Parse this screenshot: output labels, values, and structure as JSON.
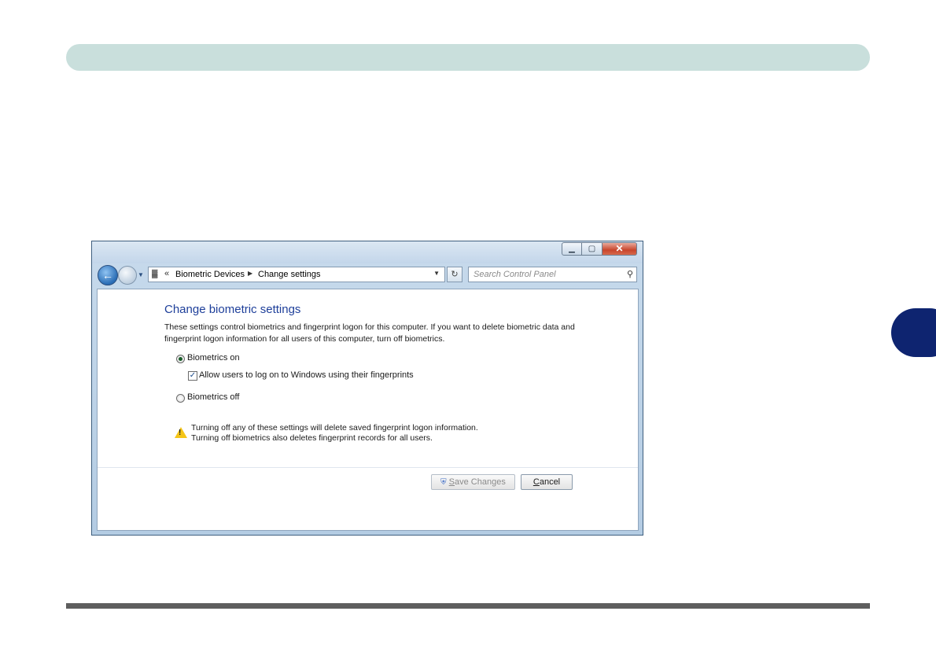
{
  "window": {
    "caption": {
      "minimize": "▁",
      "maximize": "▢",
      "close": "✕"
    }
  },
  "address": {
    "chevrons": "«",
    "crumbs": [
      "Biometric Devices",
      "Change settings"
    ]
  },
  "search": {
    "placeholder": "Search Control Panel"
  },
  "page": {
    "title": "Change biometric settings",
    "description": "These settings control biometrics and fingerprint logon for this computer. If you want to delete biometric data and fingerprint logon information for all users of this computer, turn off biometrics.",
    "options": {
      "on": {
        "label": "Biometrics on",
        "checked": true
      },
      "allow": {
        "label": "Allow users to log on to Windows using their fingerprints",
        "checked": true
      },
      "off": {
        "label": "Biometrics off",
        "checked": false
      }
    },
    "warning": {
      "line1": "Turning off any of these settings will delete saved fingerprint logon information.",
      "line2": "Turning off biometrics also deletes fingerprint records for all users."
    }
  },
  "buttons": {
    "save": {
      "underline": "S",
      "rest": "ave Changes",
      "disabled": true
    },
    "cancel": {
      "underline": "C",
      "rest": "ancel"
    }
  },
  "icons": {
    "back": "back-arrow-icon",
    "forward": "forward-arrow-icon",
    "refresh": "refresh-icon",
    "search": "search-icon",
    "warning": "warning-icon",
    "shield": "uac-shield-icon"
  },
  "colors": {
    "accent_tab": "#0e2470",
    "header_bar": "#c9dfdc",
    "title_text": "#1e3f9a"
  }
}
